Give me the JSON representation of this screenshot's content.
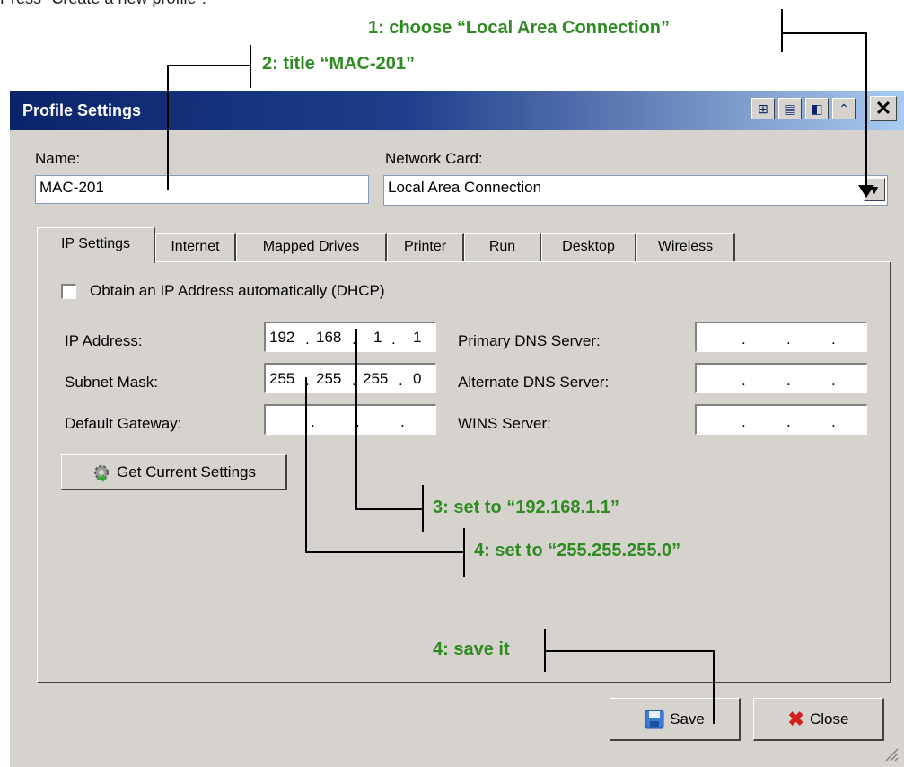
{
  "doc": {
    "top_text": "Press \"Create a new profile\"."
  },
  "annotations": {
    "step1": "1: choose “Local Area Connection”",
    "step2": "2: title “MAC-201”",
    "step3": "3: set to “192.168.1.1”",
    "step4a": "4: set to “255.255.255.0”",
    "step4b": "4: save it",
    "color": "#2e8b22"
  },
  "dialog": {
    "title": "Profile Settings",
    "close_glyph": "✕",
    "name_label": "Name:",
    "name_value": "MAC-201",
    "network_label": "Network Card:",
    "network_value": "Local Area Connection",
    "tabs": [
      "IP Settings",
      "Internet",
      "Mapped Drives",
      "Printer",
      "Run",
      "Desktop",
      "Wireless"
    ],
    "active_tab": "IP Settings",
    "dhcp_label": "Obtain an IP Address automatically (DHCP)",
    "ip_label": "IP Address:",
    "ip_value": [
      "192",
      "168",
      "1",
      "1"
    ],
    "subnet_label": "Subnet Mask:",
    "subnet_value": [
      "255",
      "255",
      "255",
      "0"
    ],
    "gateway_label": "Default Gateway:",
    "primary_dns_label": "Primary DNS Server:",
    "alternate_dns_label": "Alternate DNS Server:",
    "wins_label": "WINS Server:",
    "get_settings_label": "Get Current Settings",
    "save_label": "Save",
    "close_label": "Close"
  }
}
